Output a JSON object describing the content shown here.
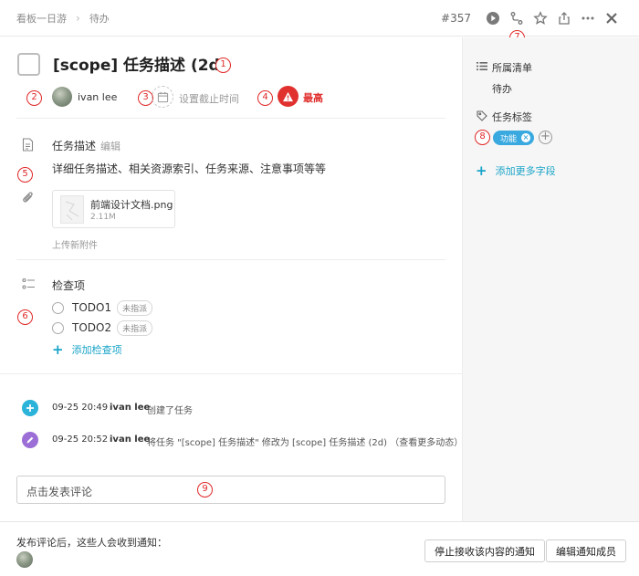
{
  "header": {
    "breadcrumbs": [
      "看板一日游",
      "待办"
    ],
    "task_id": "#357"
  },
  "task": {
    "title": "[scope] 任务描述 (2d)",
    "owner": "ivan lee",
    "due_placeholder": "设置截止时间",
    "priority": "最高",
    "priority_color": "#e0312f"
  },
  "description": {
    "label": "任务描述",
    "edit": "编辑",
    "text": "详细任务描述、相关资源索引、任务来源、注意事项等等"
  },
  "attachment": {
    "name": "前端设计文档.png",
    "size": "2.11M",
    "upload": "上传新附件"
  },
  "checklist": {
    "label": "检查项",
    "items": [
      {
        "label": "TODO1",
        "status": "未指派"
      },
      {
        "label": "TODO2",
        "status": "未指派"
      }
    ],
    "add": "添加检查项"
  },
  "activity": [
    {
      "time": "09-25 20:49",
      "user": "ivan lee",
      "text": "创建了任务"
    },
    {
      "time": "09-25 20:52",
      "user": "ivan lee",
      "text": "将任务 \"[scope] 任务描述\" 修改为 [scope] 任务描述 (2d) （查看更多动态）"
    }
  ],
  "comment": {
    "placeholder": "点击发表评论"
  },
  "sidebar": {
    "list_label": "所属清单",
    "list_value": "待办",
    "tags_label": "任务标签",
    "tags": [
      "功能"
    ],
    "add_field": "添加更多字段"
  },
  "footer": {
    "notify_text": "发布评论后，这些人会收到通知：",
    "stop_button": "停止接收该内容的通知",
    "edit_button": "编辑通知成员"
  },
  "annotations": [
    "1",
    "2",
    "3",
    "4",
    "5",
    "6",
    "7",
    "8",
    "9"
  ],
  "colors": {
    "accent": "#1aa4c8",
    "tag": "#3aa9e0",
    "annotation": "#e02828",
    "create_activity": "#2bb3d9",
    "edit_activity": "#9b6fd6"
  }
}
